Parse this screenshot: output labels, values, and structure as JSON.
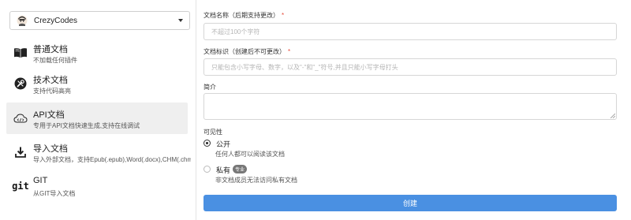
{
  "workspace": {
    "name": "CrezyCodes"
  },
  "doc_types": [
    {
      "icon": "book-icon",
      "title": "普通文档",
      "desc": "不加载任何插件"
    },
    {
      "icon": "tools-icon",
      "title": "技术文档",
      "desc": "支持代码高亮"
    },
    {
      "icon": "cloud-api-icon",
      "title": "API文档",
      "desc": "专用于API文档快速生成,支持在线调试"
    },
    {
      "icon": "download-icon",
      "title": "导入文档",
      "desc": "导入外部文档，支持Epub(.epub),Word(.docx),CHM(.chm)"
    },
    {
      "icon": "git-icon",
      "title": "GIT",
      "desc": "从GIT导入文档"
    }
  ],
  "selected_index": 2,
  "form": {
    "name_label": "文档名称（后期支持更改）",
    "name_placeholder": "不超过100个字符",
    "slug_label": "文档标识（创建后不可更改）",
    "slug_placeholder": "只能包含小写字母、数字，以及\"-\"和\"_\"符号,并且只能小写字母打头",
    "intro_label": "简介",
    "visibility_label": "可见性",
    "public_label": "公开",
    "public_desc": "任何人都可以阅读该文档",
    "private_label": "私有",
    "private_badge": "专业",
    "private_desc": "非文档成员无法访问私有文档",
    "required_mark": "*",
    "create_button": "创建"
  },
  "colors": {
    "accent": "#4a90e2",
    "required": "#e74c3c",
    "selected_bg": "#efefef"
  }
}
